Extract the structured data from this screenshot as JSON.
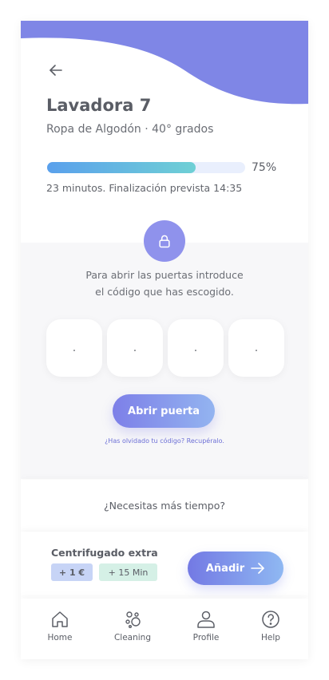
{
  "header": {
    "title": "Lavadora 7",
    "subtitle": "Ropa de Algodón · 40° grados",
    "back_icon": "arrow-left-icon"
  },
  "progress": {
    "value": 75,
    "percent_label": "75%",
    "status_text": "23 minutos. Finalización prevista 14:35"
  },
  "lock": {
    "icon": "lock-icon",
    "instructions_line1": "Para abrir las puertas introduce",
    "instructions_line2": "el código que has escogido.",
    "code_placeholders": [
      ".",
      ".",
      ".",
      "."
    ],
    "open_button_label": "Abrir puerta",
    "forgot_link": "¿Has olvidado tu código? Recupéralo."
  },
  "extra_time": {
    "question": "¿Necesitas más tiempo?",
    "option_title": "Centrifugado extra",
    "price_badge": "+ 1 €",
    "time_badge": "+ 15 Min",
    "add_button_label": "Añadir"
  },
  "nav": {
    "items": [
      {
        "label": "Home",
        "icon": "home-icon"
      },
      {
        "label": "Cleaning",
        "icon": "cleaning-icon"
      },
      {
        "label": "Profile",
        "icon": "profile-icon"
      },
      {
        "label": "Help",
        "icon": "help-icon"
      }
    ]
  },
  "colors": {
    "accent": "#7f86e6",
    "progress_start": "#5aa0ec",
    "progress_end": "#6fd0d5",
    "link": "#6d70d6"
  }
}
